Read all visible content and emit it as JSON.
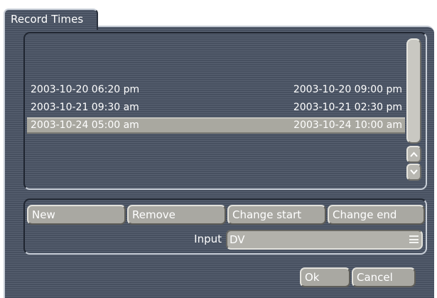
{
  "dialog": {
    "title": "Record Times"
  },
  "record_list": {
    "rows": [
      {
        "start": "2003-10-20 06:20 pm",
        "end": "2003-10-20 09:00 pm",
        "selected": false
      },
      {
        "start": "2003-10-21 09:30 am",
        "end": "2003-10-21 02:30 pm",
        "selected": false
      },
      {
        "start": "2003-10-24 05:00 am",
        "end": "2003-10-24 10:00 am",
        "selected": true
      }
    ]
  },
  "scrollbar": {
    "up_icon": "chevron-up-icon",
    "down_icon": "chevron-down-icon"
  },
  "actions": {
    "new_label": "New",
    "remove_label": "Remove",
    "change_start_label": "Change start",
    "change_end_label": "Change end"
  },
  "input": {
    "label": "Input",
    "value": "DV",
    "menu_icon": "menu-icon"
  },
  "footer": {
    "ok_label": "Ok",
    "cancel_label": "Cancel"
  },
  "colors": {
    "panel": "#4b5566",
    "button": "#a9a8a2",
    "selection": "#a9a8a0",
    "text": "#ffffff"
  }
}
